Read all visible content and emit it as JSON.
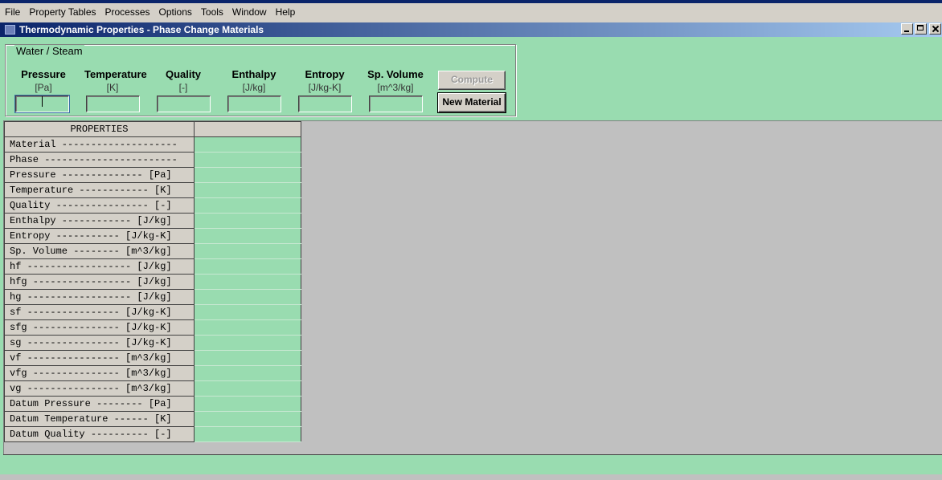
{
  "menu": [
    "File",
    "Property Tables",
    "Processes",
    "Options",
    "Tools",
    "Window",
    "Help"
  ],
  "window": {
    "title": "Thermodynamic Properties - Phase Change Materials"
  },
  "group": {
    "title": "Water / Steam",
    "fields": [
      {
        "label": "Pressure",
        "unit": "[Pa]",
        "value": ""
      },
      {
        "label": "Temperature",
        "unit": "[K]",
        "value": ""
      },
      {
        "label": "Quality",
        "unit": "[-]",
        "value": ""
      },
      {
        "label": "Enthalpy",
        "unit": "[J/kg]",
        "value": ""
      },
      {
        "label": "Entropy",
        "unit": "[J/kg-K]",
        "value": ""
      },
      {
        "label": "Sp. Volume",
        "unit": "[m^3/kg]",
        "value": ""
      }
    ],
    "compute_label": "Compute",
    "new_material_label": "New Material"
  },
  "grid": {
    "header": "PROPERTIES",
    "header_value": "",
    "rows": [
      "Material --------------------",
      "Phase -----------------------",
      "Pressure -------------- [Pa]",
      "Temperature ------------ [K]",
      "Quality ---------------- [-]",
      "Enthalpy ------------ [J/kg]",
      "Entropy ----------- [J/kg-K]",
      "Sp. Volume -------- [m^3/kg]",
      "hf ------------------ [J/kg]",
      "hfg ----------------- [J/kg]",
      "hg ------------------ [J/kg]",
      "sf ---------------- [J/kg-K]",
      "sfg --------------- [J/kg-K]",
      "sg ---------------- [J/kg-K]",
      "vf ---------------- [m^3/kg]",
      "vfg --------------- [m^3/kg]",
      "vg ---------------- [m^3/kg]",
      "Datum Pressure -------- [Pa]",
      "Datum Temperature ------ [K]",
      "Datum Quality ---------- [-]"
    ]
  }
}
